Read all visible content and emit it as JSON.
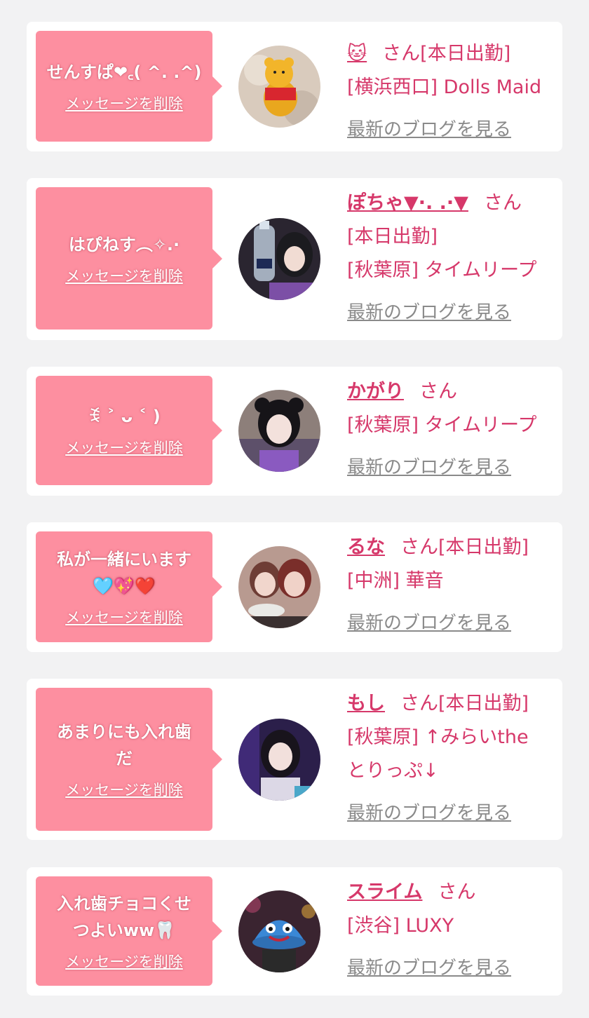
{
  "colors": {
    "accent": "#d6386a",
    "bubble": "#fd8fa0",
    "link_gray": "#8a8a8a",
    "background": "#f2f2f3"
  },
  "delete_label": "メッセージを削除",
  "blog_label": "最新のブログを見る",
  "san_label": "さん",
  "cards": [
    {
      "message": "せんすぱ❤︎꜀( ^. .^)",
      "name": "🐱",
      "status": "[本日出勤]",
      "shop": "[横浜西口] Dolls Maid",
      "avatar": "teddy-bear-avatar"
    },
    {
      "message": "はぴねす︵✧.·",
      "name": "ぽちゃ▼·. .·▼",
      "status": "[本日出勤]",
      "shop": "[秋葉原] タイムリープ",
      "avatar": "girl-with-bottle-avatar"
    },
    {
      "message": "ꉂ ˃ ᴗ ˂ )",
      "name": "かがり",
      "status": "",
      "shop": "[秋葉原] タイムリープ",
      "avatar": "girl-twin-buns-avatar"
    },
    {
      "message": "私が一緒にいます\n🩵💖❤️",
      "name": "るな",
      "status": "[本日出勤]",
      "shop": "[中洲] 華音",
      "avatar": "two-girls-eating-avatar"
    },
    {
      "message": "あまりにも入れ歯\nだ",
      "name": "もし",
      "status": "[本日出勤]",
      "shop": "[秋葉原] ↑みらいthe\nとりっぷ↓",
      "avatar": "girl-dark-hair-avatar"
    },
    {
      "message": "入れ歯チョコくせ\nつよいww🦷",
      "name": "スライム",
      "status": "",
      "shop": "[渋谷] LUXY",
      "avatar": "slime-costume-avatar"
    }
  ]
}
